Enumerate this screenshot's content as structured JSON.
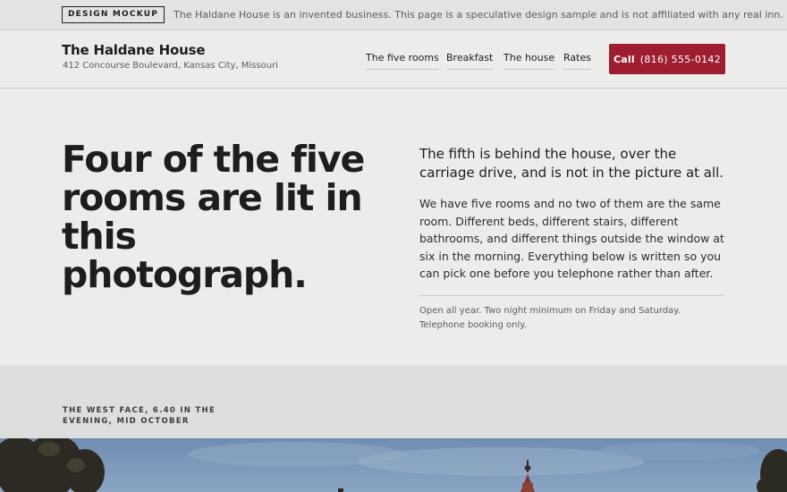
{
  "mockup_banner": {
    "tag": "DESIGN MOCKUP",
    "text": "The Haldane House is an invented business. This page is a speculative design sample and is not affiliated with any real inn."
  },
  "header": {
    "brand": "The Haldane House",
    "address": "412 Concourse Boulevard, Kansas City, Missouri",
    "nav": [
      "The five rooms",
      "Breakfast",
      "The house",
      "Rates"
    ],
    "cta_label": "Call",
    "cta_phone": "(816) 555-0142"
  },
  "hero": {
    "headline": "Four of the five rooms are lit in this photograph.",
    "lead": "The fifth is behind the house, over the carriage drive, and is not in the picture at all.",
    "body": "We have five rooms and no two of them are the same room. Different beds, different stairs, different bathrooms, and different things outside the window at six in the morning. Everything below is written so you can pick one before you telephone rather than after.",
    "note": "Open all year. Two night minimum on Friday and Saturday. Telephone booking only."
  },
  "photo_section": {
    "caption": "THE WEST FACE, 6.40 IN THE EVENING, MID OCTOBER"
  },
  "colors": {
    "accent": "#9e1d31",
    "background": "#ecedeb",
    "band": "#dcdfdb",
    "sky": "#7a96b8"
  }
}
